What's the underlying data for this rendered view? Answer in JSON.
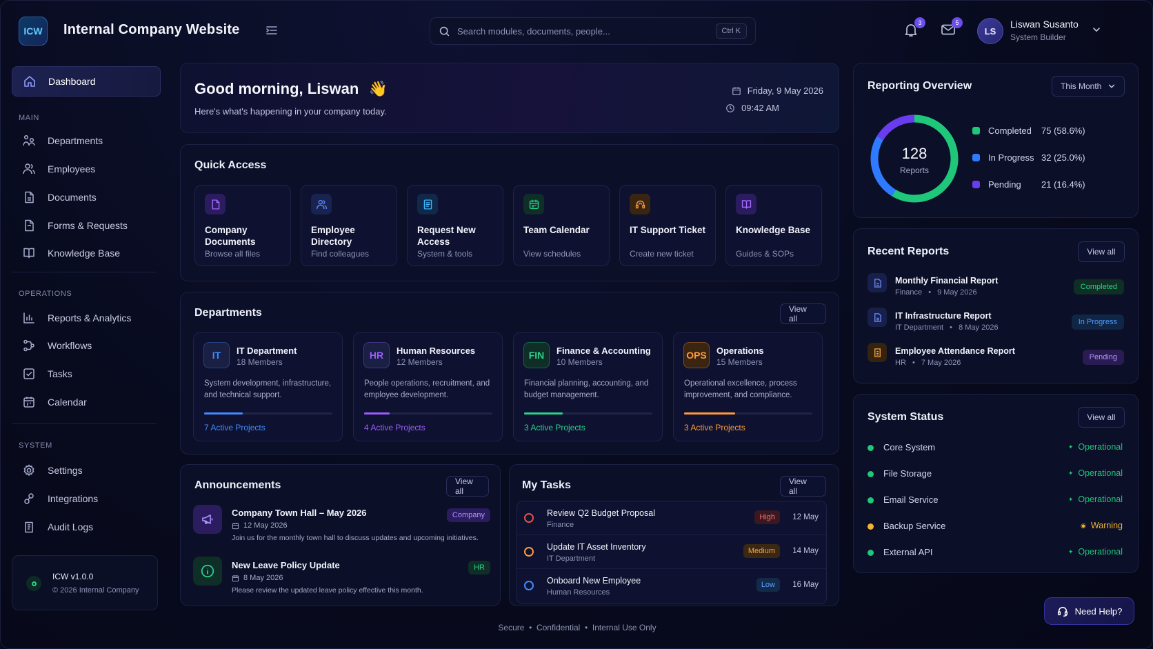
{
  "header": {
    "logo_text": "ICW",
    "app_title": "Internal Company Website",
    "search_placeholder": "Search modules, documents, people...",
    "search_shortcut": "Ctrl K",
    "notifications_count": "3",
    "messages_count": "5",
    "user": {
      "initials": "LS",
      "name": "Liswan Susanto",
      "role": "System Builder"
    }
  },
  "sidebar": {
    "dashboard": "Dashboard",
    "sections": {
      "main": "MAIN",
      "operations": "OPERATIONS",
      "system": "SYSTEM"
    },
    "main_items": [
      "Departments",
      "Employees",
      "Documents",
      "Forms & Requests",
      "Knowledge Base"
    ],
    "operations_items": [
      "Reports & Analytics",
      "Workflows",
      "Tasks",
      "Calendar"
    ],
    "system_items": [
      "Settings",
      "Integrations",
      "Audit Logs"
    ],
    "version": "ICW v1.0.0",
    "copyright": "© 2026 Internal Company"
  },
  "welcome": {
    "greeting": "Good morning, Liswan",
    "emoji": "👋",
    "subtitle": "Here's what's happening in your company today.",
    "date": "Friday, 9 May 2026",
    "time": "09:42 AM"
  },
  "quick_access": {
    "title": "Quick Access",
    "items": [
      {
        "title": "Company Documents",
        "subtitle": "Browse all files",
        "icon": "document-icon",
        "color": "#a46bff"
      },
      {
        "title": "Employee Directory",
        "subtitle": "Find colleagues",
        "icon": "users-icon",
        "color": "#5a8dff"
      },
      {
        "title": "Request New Access",
        "subtitle": "System & tools",
        "icon": "form-icon",
        "color": "#3fb7ff"
      },
      {
        "title": "Team Calendar",
        "subtitle": "View schedules",
        "icon": "calendar-icon",
        "color": "#2ad28b"
      },
      {
        "title": "IT Support Ticket",
        "subtitle": "Create new ticket",
        "icon": "headset-icon",
        "color": "#ff9a3c"
      },
      {
        "title": "Knowledge Base",
        "subtitle": "Guides & SOPs",
        "icon": "book-icon",
        "color": "#a46bff"
      }
    ]
  },
  "departments": {
    "title": "Departments",
    "view_all": "View all",
    "items": [
      {
        "code": "IT",
        "name": "IT Department",
        "members": "18 Members",
        "desc": "System development, infrastructure, and technical support.",
        "projects": "7 Active Projects",
        "color": "#3f8cff",
        "progress": 0.3
      },
      {
        "code": "HR",
        "name": "Human Resources",
        "members": "12 Members",
        "desc": "People operations, recruitment, and employee development.",
        "projects": "4 Active Projects",
        "color": "#9b5cff",
        "progress": 0.2
      },
      {
        "code": "FIN",
        "name": "Finance & Accounting",
        "members": "10 Members",
        "desc": "Financial planning, accounting, and budget management.",
        "projects": "3 Active Projects",
        "color": "#2ad28b",
        "progress": 0.3
      },
      {
        "code": "OPS",
        "name": "Operations",
        "members": "15 Members",
        "desc": "Operational excellence, process improvement, and compliance.",
        "projects": "3 Active Projects",
        "color": "#ff9a3c",
        "progress": 0.4
      }
    ]
  },
  "announcements": {
    "title": "Announcements",
    "view_all": "View all",
    "items": [
      {
        "title": "Company Town Hall – May 2026",
        "date": "12 May 2026",
        "body": "Join us for the monthly town hall to discuss updates and upcoming initiatives.",
        "tag": "Company",
        "icon": "megaphone-icon"
      },
      {
        "title": "New Leave Policy Update",
        "date": "8 May 2026",
        "body": "Please review the updated leave policy effective this month.",
        "tag": "HR",
        "icon": "info-icon"
      }
    ]
  },
  "tasks": {
    "title": "My Tasks",
    "view_all": "View all",
    "items": [
      {
        "title": "Review Q2 Budget Proposal",
        "dept": "Finance",
        "priority": "High",
        "date": "12 May"
      },
      {
        "title": "Update IT Asset Inventory",
        "dept": "IT Department",
        "priority": "Medium",
        "date": "14 May"
      },
      {
        "title": "Onboard New Employee",
        "dept": "Human Resources",
        "priority": "Low",
        "date": "16 May"
      }
    ]
  },
  "reporting": {
    "title": "Reporting Overview",
    "period": "This Month",
    "total": "128",
    "total_label": "Reports",
    "legend": [
      {
        "label": "Completed",
        "value": "75 (58.6%)",
        "count": 75,
        "color": "#1fc77a"
      },
      {
        "label": "In Progress",
        "value": "32 (25.0%)",
        "count": 32,
        "color": "#2f7bff"
      },
      {
        "label": "Pending",
        "value": "21 (16.4%)",
        "count": 21,
        "color": "#6a3cf0"
      }
    ]
  },
  "recent_reports": {
    "title": "Recent Reports",
    "view_all": "View all",
    "items": [
      {
        "title": "Monthly Financial Report",
        "dept": "Finance",
        "date": "9 May 2026",
        "status": "Completed"
      },
      {
        "title": "IT Infrastructure Report",
        "dept": "IT Department",
        "date": "8 May 2026",
        "status": "In Progress"
      },
      {
        "title": "Employee Attendance Report",
        "dept": "HR",
        "date": "7 May 2026",
        "status": "Pending"
      }
    ]
  },
  "system_status": {
    "title": "System Status",
    "view_all": "View all",
    "items": [
      {
        "name": "Core System",
        "status": "Operational"
      },
      {
        "name": "File Storage",
        "status": "Operational"
      },
      {
        "name": "Email Service",
        "status": "Operational"
      },
      {
        "name": "Backup Service",
        "status": "Warning"
      },
      {
        "name": "External API",
        "status": "Operational"
      }
    ]
  },
  "footer": {
    "text": "Secure  •  Confidential  •  Internal Use Only"
  },
  "help": {
    "label": "Need Help?"
  }
}
